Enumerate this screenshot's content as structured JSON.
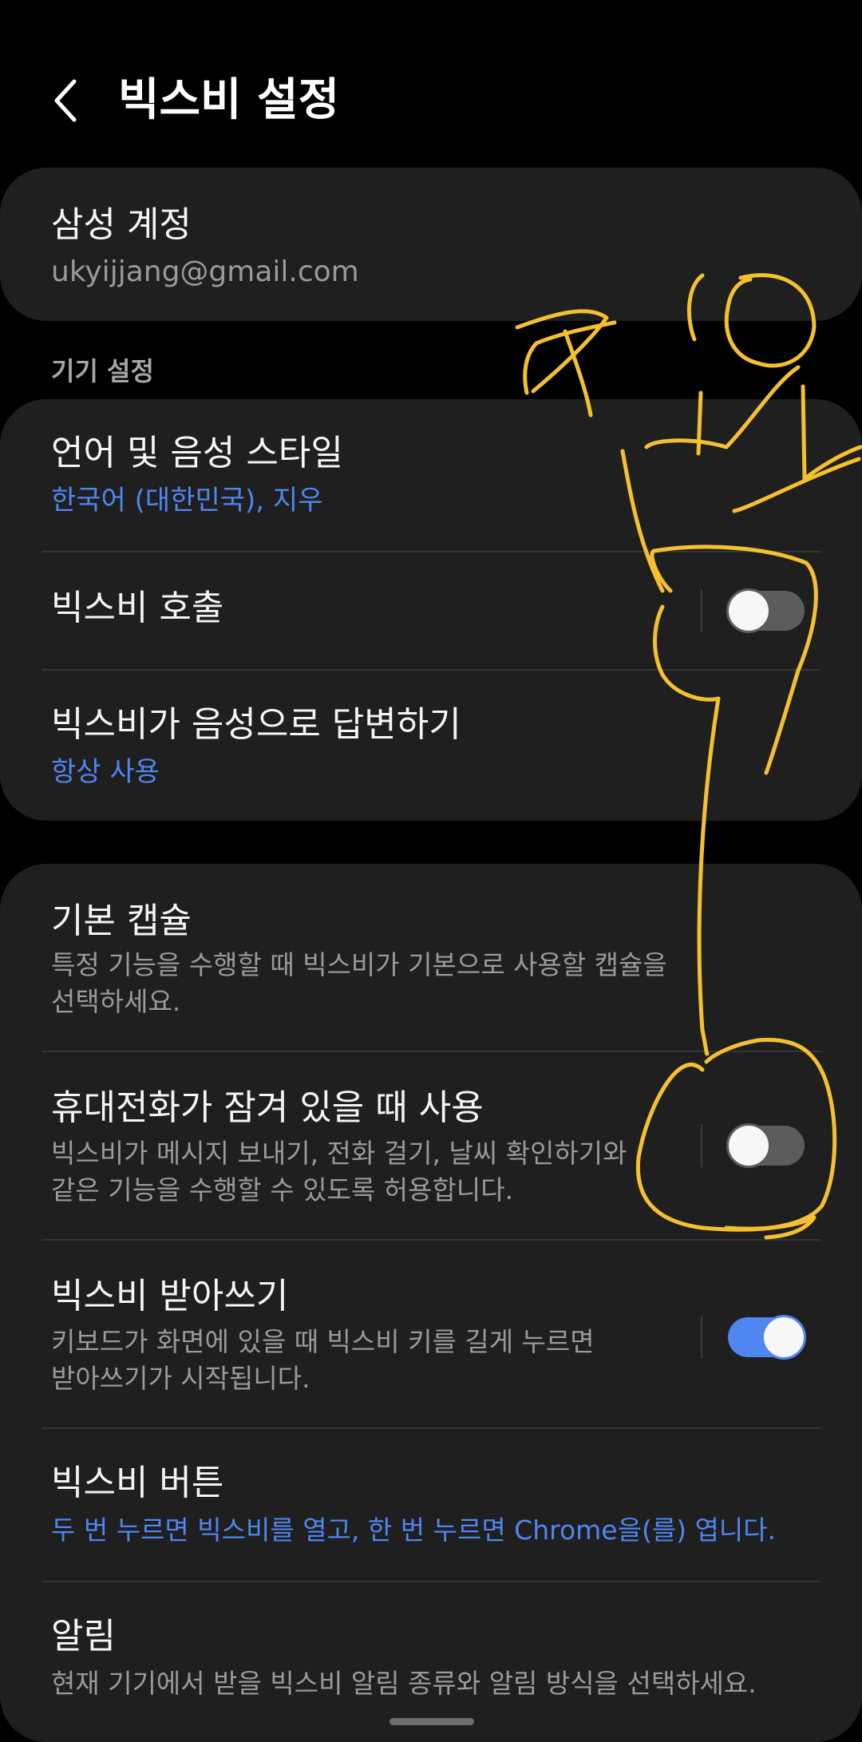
{
  "header": {
    "back_icon": "chevron-left-icon",
    "title": "빅스비 설정"
  },
  "account": {
    "title": "삼성 계정",
    "email": "ukyijjang@gmail.com"
  },
  "device_settings": {
    "section_label": "기기 설정",
    "language": {
      "title": "언어 및 음성 스타일",
      "value": "한국어 (대한민국), 지우"
    },
    "wake": {
      "title": "빅스비 호출",
      "enabled": false
    },
    "voice_response": {
      "title": "빅스비가 음성으로 답변하기",
      "value": "항상 사용"
    }
  },
  "more_settings": {
    "default_capsule": {
      "title": "기본 캡슐",
      "desc_line1": "특정 기능을 수행할 때 빅스비가 기본으로 사용할 캡슐을",
      "desc_line2": "선택하세요."
    },
    "locked_use": {
      "title": "휴대전화가 잠겨 있을 때 사용",
      "desc_line1": "빅스비가 메시지 보내기, 전화 걸기, 날씨 확인하기와",
      "desc_line2": "같은 기능을 수행할 수 있도록 허용합니다.",
      "enabled": false
    },
    "dictation": {
      "title": "빅스비 받아쓰기",
      "desc_line1": "키보드가 화면에 있을 때 빅스비 키를 길게 누르면",
      "desc_line2": "받아쓰기가 시작됩니다.",
      "enabled": true
    },
    "bixby_button": {
      "title": "빅스비 버튼",
      "value": "두 번 누르면 빅스비를 열고, 한 번 누르면 Chrome을(를) 엽니다."
    },
    "notifications": {
      "title": "알림",
      "desc": "현재 기기에서 받을 빅스비 알림 종류와 알림 방식을 선택하세요."
    }
  },
  "colors": {
    "background": "#000000",
    "card": "#1f1f1f",
    "accent": "#4f86f0",
    "toggle_off": "#5c5c5c",
    "annotation": "#f5c030"
  }
}
